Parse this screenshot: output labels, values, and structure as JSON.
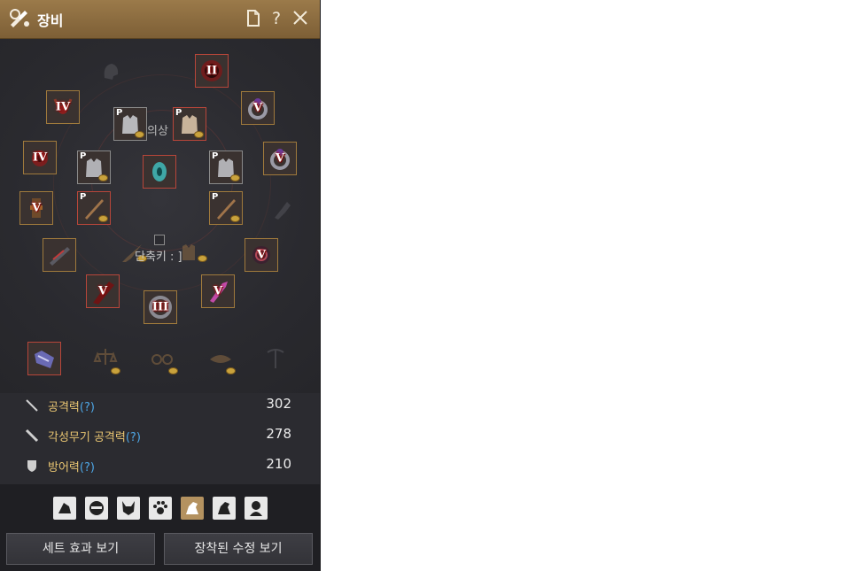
{
  "window": {
    "title": "장비",
    "toolbar": {
      "help_label": "?"
    }
  },
  "equipment": {
    "outfit_label": "의상",
    "shortcut_label": "단축키 : ]",
    "slots": [
      {
        "name": "slot-helmet-top",
        "badge": "II"
      },
      {
        "name": "slot-left-1",
        "badge": "IV"
      },
      {
        "name": "slot-left-2",
        "badge": "IV"
      },
      {
        "name": "slot-left-3",
        "badge": "V"
      },
      {
        "name": "slot-right-ring-1",
        "badge": "V"
      },
      {
        "name": "slot-right-ring-2",
        "badge": "V"
      },
      {
        "name": "slot-right-belt",
        "badge": "V"
      },
      {
        "name": "slot-bottom-left",
        "badge": "V"
      },
      {
        "name": "slot-bottom-right",
        "badge": "V"
      },
      {
        "name": "slot-bottom-center",
        "badge": "III"
      }
    ],
    "p_mark": "P"
  },
  "stats": {
    "attack": {
      "label": "공격력",
      "q": "(?)",
      "value": "302"
    },
    "awakening_attack": {
      "label": "각성무기 공격력",
      "q": "(?)",
      "value": "278"
    },
    "defense": {
      "label": "방어력",
      "q": "(?)",
      "value": "210"
    }
  },
  "buttons": {
    "set_effect": "세트 효과 보기",
    "equipped_crystals": "장착된 수정 보기"
  },
  "colors": {
    "title_bar": "#8d6c40",
    "panel_bg": "#2b2b30",
    "stat_label": "#e8c572",
    "help_link": "#4ea7e6",
    "slot_border_gold": "#a07a3c",
    "slot_border_red": "#b8463a",
    "active_tab": "#b49260"
  }
}
